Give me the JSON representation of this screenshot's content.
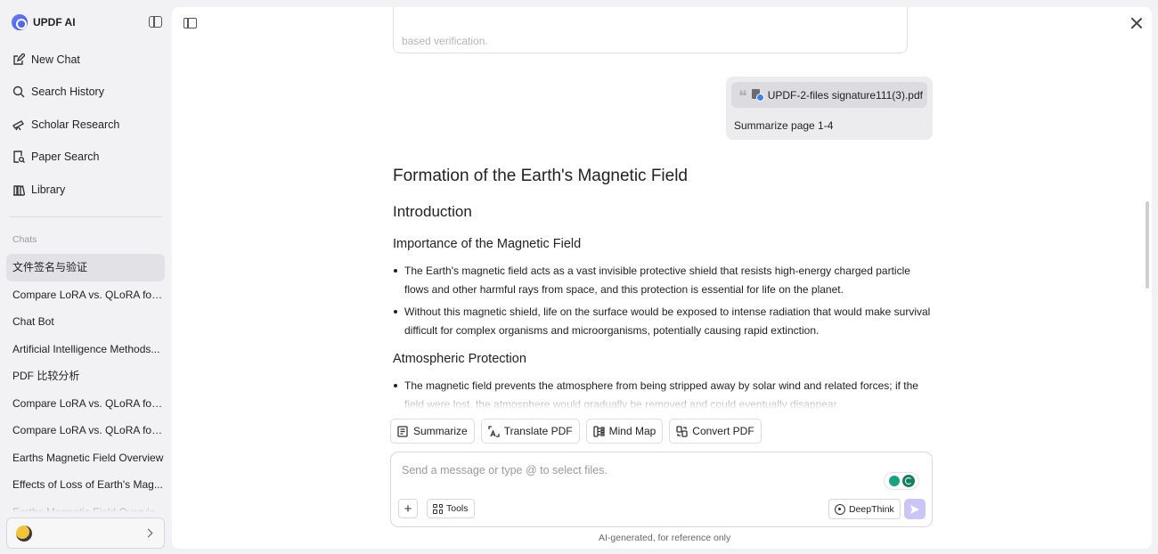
{
  "app": {
    "name": "UPDF AI"
  },
  "sidebar": {
    "nav": [
      {
        "label": "New Chat",
        "icon": "edit-icon"
      },
      {
        "label": "Search History",
        "icon": "search-icon"
      },
      {
        "label": "Scholar Research",
        "icon": "telescope-icon"
      },
      {
        "label": "Paper Search",
        "icon": "document-search-icon"
      },
      {
        "label": "Library",
        "icon": "library-icon"
      }
    ],
    "chats_label": "Chats",
    "chats": [
      "文件签名与验证",
      "Compare LoRA vs. QLoRA for ...",
      "Chat Bot",
      "Artificial Intelligence Methods...",
      "PDF 比较分析",
      "Compare LoRA vs. QLoRA for ...",
      "Compare LoRA vs. QLoRA for ...",
      "Earths Magnetic Field Overview",
      "Effects of Loss of Earth's Mag...",
      "Earths Magnetic Field Overvie..."
    ]
  },
  "conversation": {
    "previous_input_text": "based verification.",
    "user_message": {
      "file_name": "UPDF-2-files signature111(3).pdf",
      "text": "Summarize page 1-4"
    },
    "answer": {
      "title": "Formation of the Earth's Magnetic Field",
      "intro": "Introduction",
      "sections": [
        {
          "heading": "Importance of the Magnetic Field",
          "bullets": [
            "The Earth's magnetic field acts as a vast invisible protective shield that resists high-energy charged particle flows and other harmful rays from space, and this protection is essential for life on the planet.",
            "Without this magnetic shield, life on the surface would be exposed to intense radiation that would make survival difficult for complex organisms and microorganisms, potentially causing rapid extinction."
          ]
        },
        {
          "heading": "Atmospheric Protection",
          "bullets": [
            "The magnetic field prevents the atmosphere from being stripped away by solar wind and related forces; if the field were lost, the atmosphere would gradually be removed and could eventually disappear."
          ]
        }
      ]
    }
  },
  "quick_actions": [
    "Summarize",
    "Translate PDF",
    "Mind Map",
    "Convert PDF"
  ],
  "composer": {
    "placeholder": "Send a message or type @ to select files.",
    "tools_label": "Tools",
    "deepthink_label": "DeepThink",
    "plus_label": "+"
  },
  "disclaimer": "AI-generated, for reference only",
  "colors": {
    "send_button": "#c9c6f7",
    "active_chat": "#e2e2e6"
  }
}
